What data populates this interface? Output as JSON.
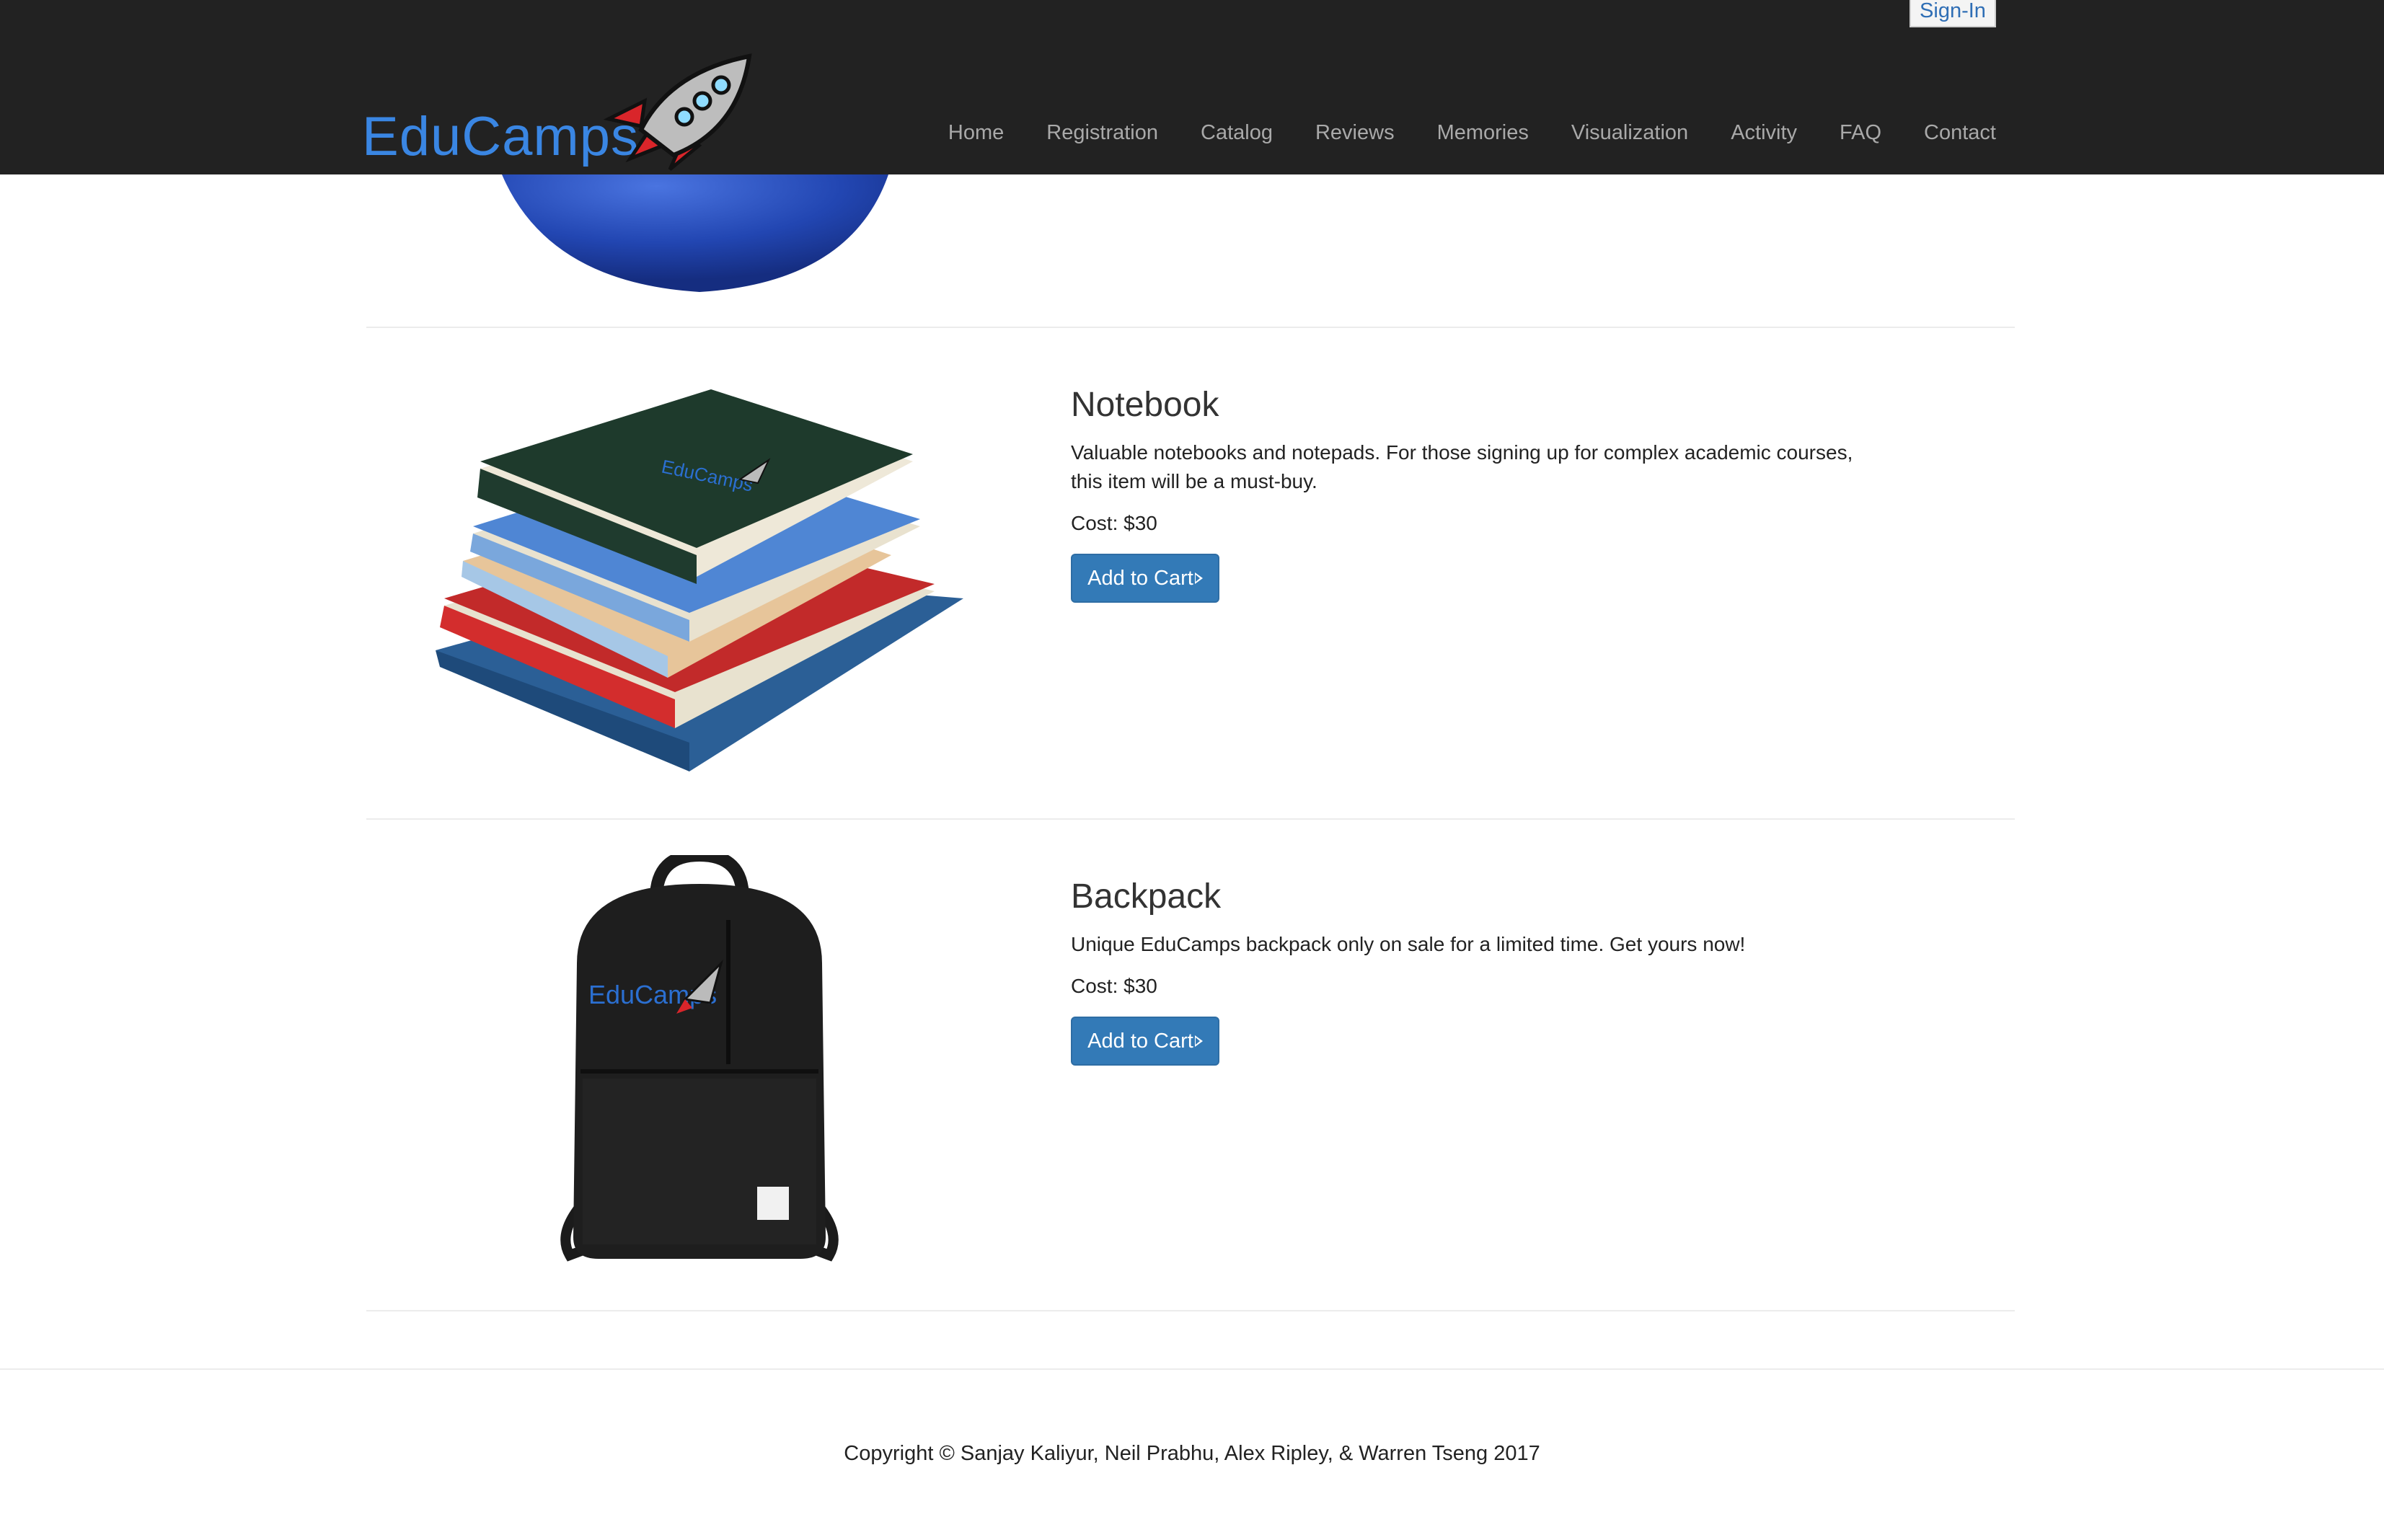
{
  "auth": {
    "signin_label": "Sign-In"
  },
  "brand": {
    "logo_text": "EduCamps",
    "accent": "#3a86e3"
  },
  "nav": {
    "items": [
      {
        "label": "Home"
      },
      {
        "label": "Registration"
      },
      {
        "label": "Catalog"
      },
      {
        "label": "Reviews"
      },
      {
        "label": "Memories"
      },
      {
        "label": "Visualization"
      },
      {
        "label": "Activity"
      },
      {
        "label": "FAQ"
      },
      {
        "label": "Contact"
      }
    ]
  },
  "products": [
    {
      "name": "Notebook",
      "description": "Valuable notebooks and notepads. For those signing up for complex academic courses, this item will be a must-buy.",
      "cost": "Cost: $30",
      "button_label": "Add to Cart",
      "image": "stack-of-books-image"
    },
    {
      "name": "Backpack",
      "description": "Unique EduCamps backpack only on sale for a limited time. Get yours now!",
      "cost": "Cost: $30",
      "button_label": "Add to Cart",
      "image": "black-backpack-image"
    }
  ],
  "footer": {
    "copyright": "Copyright © Sanjay Kaliyur, Neil Prabhu, Alex Ripley, & Warren Tseng 2017"
  },
  "colors": {
    "navbar_bg": "#222222",
    "button_bg": "#337ab7",
    "ball_blue": "#2a4fb8"
  }
}
